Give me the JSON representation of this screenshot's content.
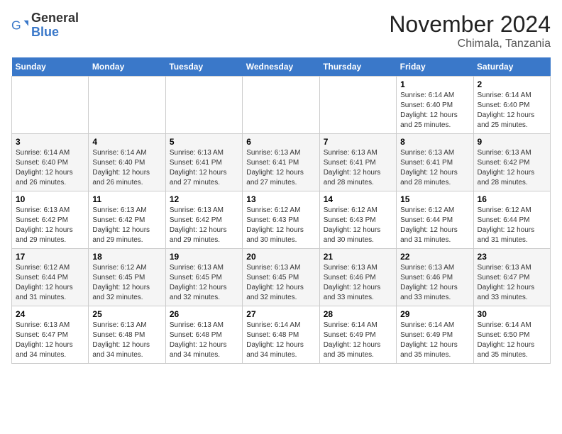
{
  "app": {
    "name_general": "General",
    "name_blue": "Blue"
  },
  "calendar": {
    "title": "November 2024",
    "location": "Chimala, Tanzania",
    "days_of_week": [
      "Sunday",
      "Monday",
      "Tuesday",
      "Wednesday",
      "Thursday",
      "Friday",
      "Saturday"
    ],
    "weeks": [
      [
        {
          "day": "",
          "info": ""
        },
        {
          "day": "",
          "info": ""
        },
        {
          "day": "",
          "info": ""
        },
        {
          "day": "",
          "info": ""
        },
        {
          "day": "",
          "info": ""
        },
        {
          "day": "1",
          "info": "Sunrise: 6:14 AM\nSunset: 6:40 PM\nDaylight: 12 hours and 25 minutes."
        },
        {
          "day": "2",
          "info": "Sunrise: 6:14 AM\nSunset: 6:40 PM\nDaylight: 12 hours and 25 minutes."
        }
      ],
      [
        {
          "day": "3",
          "info": "Sunrise: 6:14 AM\nSunset: 6:40 PM\nDaylight: 12 hours and 26 minutes."
        },
        {
          "day": "4",
          "info": "Sunrise: 6:14 AM\nSunset: 6:40 PM\nDaylight: 12 hours and 26 minutes."
        },
        {
          "day": "5",
          "info": "Sunrise: 6:13 AM\nSunset: 6:41 PM\nDaylight: 12 hours and 27 minutes."
        },
        {
          "day": "6",
          "info": "Sunrise: 6:13 AM\nSunset: 6:41 PM\nDaylight: 12 hours and 27 minutes."
        },
        {
          "day": "7",
          "info": "Sunrise: 6:13 AM\nSunset: 6:41 PM\nDaylight: 12 hours and 28 minutes."
        },
        {
          "day": "8",
          "info": "Sunrise: 6:13 AM\nSunset: 6:41 PM\nDaylight: 12 hours and 28 minutes."
        },
        {
          "day": "9",
          "info": "Sunrise: 6:13 AM\nSunset: 6:42 PM\nDaylight: 12 hours and 28 minutes."
        }
      ],
      [
        {
          "day": "10",
          "info": "Sunrise: 6:13 AM\nSunset: 6:42 PM\nDaylight: 12 hours and 29 minutes."
        },
        {
          "day": "11",
          "info": "Sunrise: 6:13 AM\nSunset: 6:42 PM\nDaylight: 12 hours and 29 minutes."
        },
        {
          "day": "12",
          "info": "Sunrise: 6:13 AM\nSunset: 6:42 PM\nDaylight: 12 hours and 29 minutes."
        },
        {
          "day": "13",
          "info": "Sunrise: 6:12 AM\nSunset: 6:43 PM\nDaylight: 12 hours and 30 minutes."
        },
        {
          "day": "14",
          "info": "Sunrise: 6:12 AM\nSunset: 6:43 PM\nDaylight: 12 hours and 30 minutes."
        },
        {
          "day": "15",
          "info": "Sunrise: 6:12 AM\nSunset: 6:44 PM\nDaylight: 12 hours and 31 minutes."
        },
        {
          "day": "16",
          "info": "Sunrise: 6:12 AM\nSunset: 6:44 PM\nDaylight: 12 hours and 31 minutes."
        }
      ],
      [
        {
          "day": "17",
          "info": "Sunrise: 6:12 AM\nSunset: 6:44 PM\nDaylight: 12 hours and 31 minutes."
        },
        {
          "day": "18",
          "info": "Sunrise: 6:12 AM\nSunset: 6:45 PM\nDaylight: 12 hours and 32 minutes."
        },
        {
          "day": "19",
          "info": "Sunrise: 6:13 AM\nSunset: 6:45 PM\nDaylight: 12 hours and 32 minutes."
        },
        {
          "day": "20",
          "info": "Sunrise: 6:13 AM\nSunset: 6:45 PM\nDaylight: 12 hours and 32 minutes."
        },
        {
          "day": "21",
          "info": "Sunrise: 6:13 AM\nSunset: 6:46 PM\nDaylight: 12 hours and 33 minutes."
        },
        {
          "day": "22",
          "info": "Sunrise: 6:13 AM\nSunset: 6:46 PM\nDaylight: 12 hours and 33 minutes."
        },
        {
          "day": "23",
          "info": "Sunrise: 6:13 AM\nSunset: 6:47 PM\nDaylight: 12 hours and 33 minutes."
        }
      ],
      [
        {
          "day": "24",
          "info": "Sunrise: 6:13 AM\nSunset: 6:47 PM\nDaylight: 12 hours and 34 minutes."
        },
        {
          "day": "25",
          "info": "Sunrise: 6:13 AM\nSunset: 6:48 PM\nDaylight: 12 hours and 34 minutes."
        },
        {
          "day": "26",
          "info": "Sunrise: 6:13 AM\nSunset: 6:48 PM\nDaylight: 12 hours and 34 minutes."
        },
        {
          "day": "27",
          "info": "Sunrise: 6:14 AM\nSunset: 6:48 PM\nDaylight: 12 hours and 34 minutes."
        },
        {
          "day": "28",
          "info": "Sunrise: 6:14 AM\nSunset: 6:49 PM\nDaylight: 12 hours and 35 minutes."
        },
        {
          "day": "29",
          "info": "Sunrise: 6:14 AM\nSunset: 6:49 PM\nDaylight: 12 hours and 35 minutes."
        },
        {
          "day": "30",
          "info": "Sunrise: 6:14 AM\nSunset: 6:50 PM\nDaylight: 12 hours and 35 minutes."
        }
      ]
    ]
  }
}
